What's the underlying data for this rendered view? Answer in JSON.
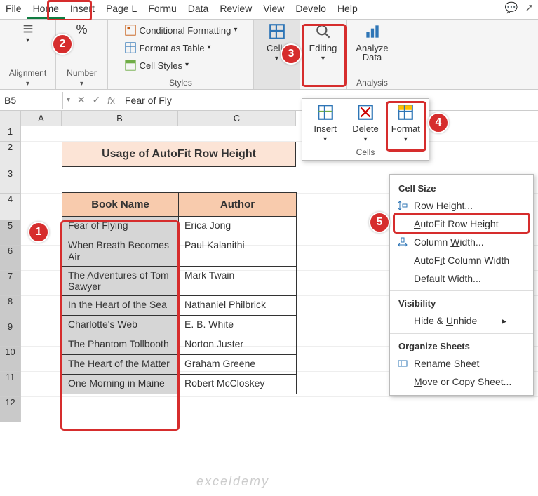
{
  "tabs": [
    "File",
    "Home",
    "Insert",
    "Page L",
    "Formu",
    "Data",
    "Review",
    "View",
    "Develo",
    "Help"
  ],
  "active_tab": "Home",
  "ribbon": {
    "alignment": {
      "label": "Alignment"
    },
    "number": {
      "label": "Number",
      "pct": "%"
    },
    "styles": {
      "label": "Styles",
      "cf": "Conditional Formatting",
      "fat": "Format as Table",
      "cs": "Cell Styles"
    },
    "cells": {
      "label": "Cells"
    },
    "editing": {
      "label": "Editing"
    },
    "analysis": {
      "label": "Analysis",
      "btn": "Analyze Data"
    }
  },
  "cells_panel": {
    "insert": "Insert",
    "delete": "Delete",
    "format": "Format",
    "label": "Cells"
  },
  "format_menu": {
    "head1": "Cell Size",
    "rowh": "Row Height...",
    "autorow": "AutoFit Row Height",
    "colw": "Column Width...",
    "autocol": "AutoFit Column Width",
    "defw": "Default Width...",
    "head2": "Visibility",
    "hide": "Hide & Unhide",
    "head3": "Organize Sheets",
    "rename": "Rename Sheet",
    "move": "Move or Copy Sheet..."
  },
  "namebox": "B5",
  "formula": "Fear of Fly",
  "cols": [
    "A",
    "B",
    "C"
  ],
  "rows": [
    "1",
    "2",
    "3",
    "4",
    "5",
    "6",
    "7",
    "8",
    "9",
    "10",
    "11",
    "12"
  ],
  "title": "Usage of AutoFit Row Height",
  "headers": {
    "book": "Book Name",
    "author": "Author"
  },
  "data": [
    {
      "book": "Fear of Flying",
      "author": "Erica Jong"
    },
    {
      "book": "When Breath Becomes Air",
      "author": "Paul Kalanithi"
    },
    {
      "book": "The Adventures of Tom Sawyer",
      "author": "Mark Twain"
    },
    {
      "book": "In the Heart of the Sea",
      "author": "Nathaniel Philbrick"
    },
    {
      "book": "Charlotte's Web",
      "author": "E. B. White"
    },
    {
      "book": "The Phantom Tollbooth",
      "author": "Norton Juster"
    },
    {
      "book": "The Heart of the Matter",
      "author": "Graham Greene"
    },
    {
      "book": "One Morning in Maine",
      "author": "Robert McCloskey"
    }
  ],
  "watermark": "exceldemy"
}
